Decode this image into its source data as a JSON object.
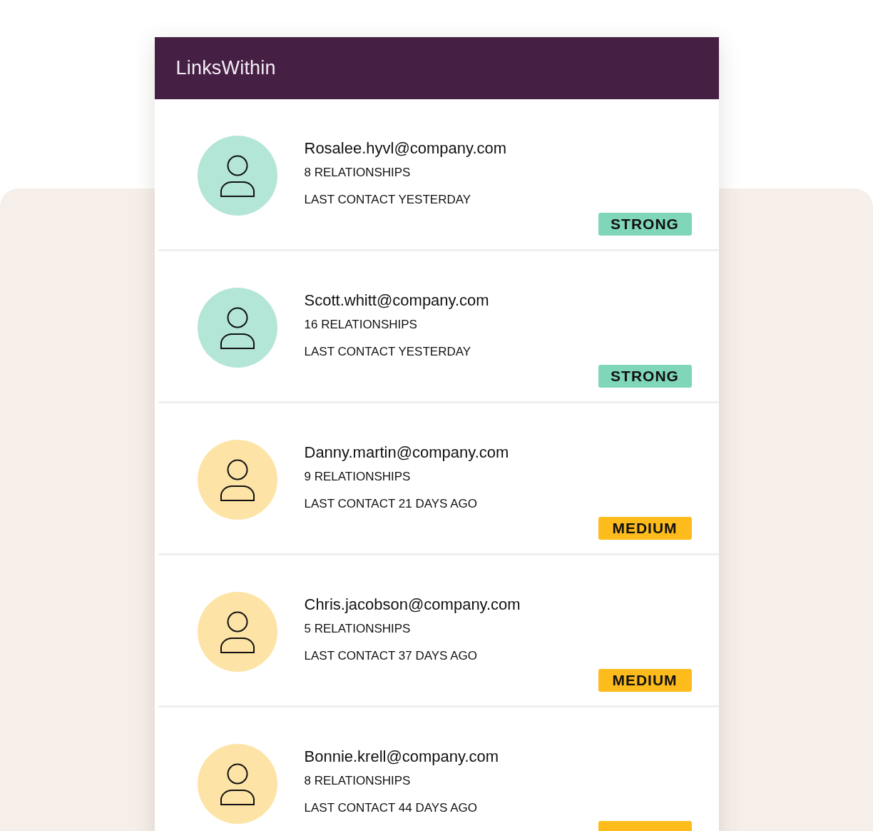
{
  "app": {
    "title": "LinksWithin"
  },
  "contacts": [
    {
      "email": "Rosalee.hyvl@company.com",
      "relationships": "8 RELATIONSHIPS",
      "last_contact": "LAST CONTACT YESTERDAY",
      "kind": "strong",
      "badge": "STRONG"
    },
    {
      "email": "Scott.whitt@company.com",
      "relationships": "16 RELATIONSHIPS",
      "last_contact": "LAST CONTACT YESTERDAY",
      "kind": "strong",
      "badge": "STRONG"
    },
    {
      "email": "Danny.martin@company.com",
      "relationships": "9 RELATIONSHIPS",
      "last_contact": "LAST CONTACT 21 DAYS AGO",
      "kind": "medium",
      "badge": "MEDIUM"
    },
    {
      "email": "Chris.jacobson@company.com",
      "relationships": "5 RELATIONSHIPS",
      "last_contact": "LAST CONTACT 37 DAYS AGO",
      "kind": "medium",
      "badge": "MEDIUM"
    },
    {
      "email": "Bonnie.krell@company.com",
      "relationships": "8 RELATIONSHIPS",
      "last_contact": "LAST CONTACT 44 DAYS AGO",
      "kind": "medium"
    }
  ]
}
